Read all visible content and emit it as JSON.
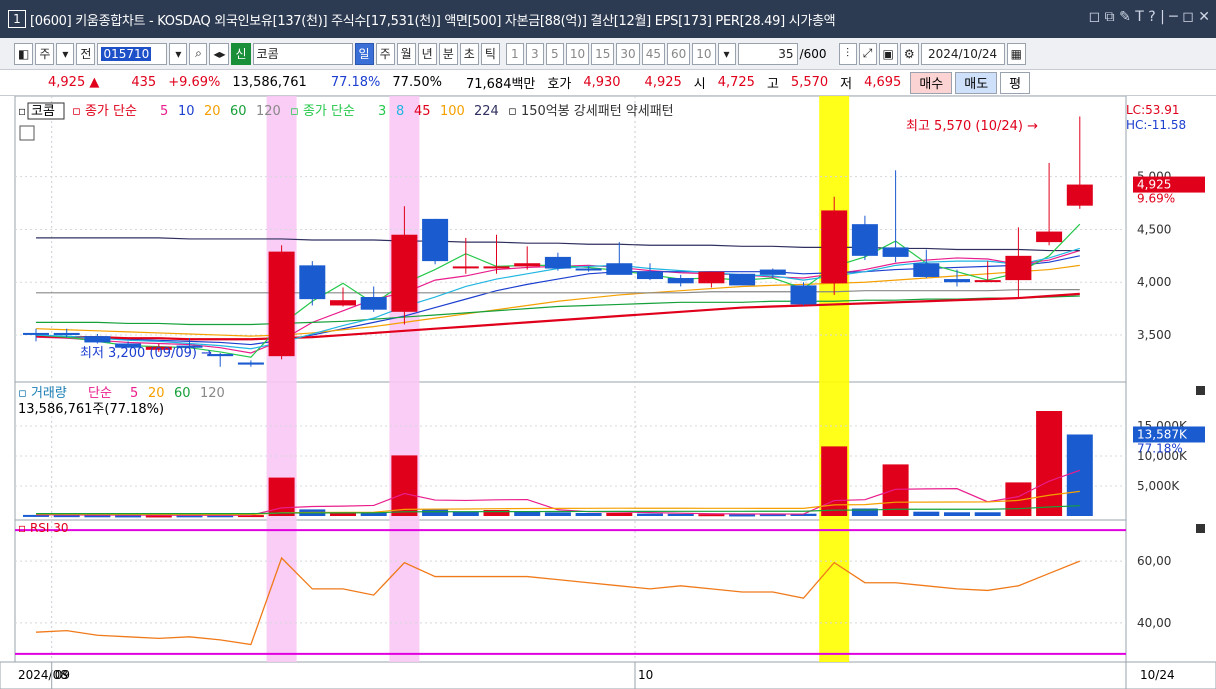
{
  "window": {
    "number": "1",
    "title": "[0600] 키움종합차트 - KOSDAQ 외국인보유[137(천)] 주식수[17,531(천)] 액면[500] 자본금[88(억)] 결산[12월] EPS[173] PER[28.49] 시가총액",
    "controls": "◻ ⧉ ✎ T ?  |  ─ ◻ ✕"
  },
  "toolbar": {
    "period_type": "주",
    "prev_label": "전",
    "code": "015710",
    "badge": "신",
    "name": "코콤",
    "periods": [
      "일",
      "주",
      "월",
      "년",
      "분",
      "초",
      "틱"
    ],
    "active_period": "일",
    "minutes": [
      "1",
      "3",
      "5",
      "10",
      "15",
      "30",
      "45",
      "60",
      "10"
    ],
    "count": "35",
    "count_total": "/600",
    "date": "2024/10/24"
  },
  "quote": {
    "price": "4,925",
    "arrow": "▲",
    "change": "435",
    "change_pct": "+9.69%",
    "volume": "13,586,761",
    "vol_ratio": "77.18%",
    "turnover": "77.50%",
    "amount": "71,684백만",
    "bid_label": "호가",
    "ask_price": "4,930",
    "bid_price": "4,925",
    "open_label": "시",
    "open": "4,725",
    "high_label": "고",
    "high": "5,570",
    "low_label": "저",
    "low": "4,695",
    "buy_label": "매수",
    "sell_label": "매도",
    "avg_label": "평"
  },
  "price_legend": {
    "name": "코콤",
    "ma_label": "종가 단순",
    "ma_periods": [
      "5",
      "10",
      "20",
      "60",
      "120"
    ],
    "ma_colors": [
      "#e91e8c",
      "#1c3fd0",
      "#f5a000",
      "#16a03a",
      "#888888"
    ],
    "ma2_label": "종가 단순",
    "ma2_periods": [
      "3",
      "8",
      "45",
      "100",
      "224"
    ],
    "ma2_colors": [
      "#25c84a",
      "#21b6e0",
      "#e0001b",
      "#f5a000",
      "#303060"
    ],
    "pattern_label": "150억봉 강세패턴  약세패턴"
  },
  "annotations": {
    "high": "최고 5,570 (10/24) →",
    "low": "최저 3,200 (09/09) →",
    "lc": "LC:53.91",
    "hc": "HC:-11.58",
    "last_price": "4,925",
    "last_pct": "9.69%"
  },
  "volume_legend": {
    "label": "거래량",
    "ma_label": "단순",
    "periods": [
      "5",
      "20",
      "60",
      "120"
    ],
    "colors": [
      "#e91e8c",
      "#f5a000",
      "#16a03a",
      "#888888"
    ],
    "current": "13,586,761주(77.18%)",
    "last_value": "13,587K",
    "last_pct": "77.18%"
  },
  "rsi_legend": {
    "label": "RSI 30"
  },
  "axis": {
    "dates": [
      "2024/08",
      "09",
      "10"
    ],
    "right_date": "10/24"
  },
  "chart_data": {
    "type": "candlestick",
    "price_ticks": [
      3500,
      4000,
      4500,
      5000
    ],
    "price_tick_labels": [
      "3,500",
      "4,000",
      "4,500",
      "5,000"
    ],
    "price_range": [
      3150,
      5650
    ],
    "candles": [
      {
        "o": 3520,
        "h": 3560,
        "l": 3440,
        "c": 3510
      },
      {
        "o": 3520,
        "h": 3560,
        "l": 3480,
        "c": 3500
      },
      {
        "o": 3490,
        "h": 3510,
        "l": 3420,
        "c": 3430
      },
      {
        "o": 3420,
        "h": 3440,
        "l": 3380,
        "c": 3380
      },
      {
        "o": 3360,
        "h": 3420,
        "l": 3340,
        "c": 3390
      },
      {
        "o": 3400,
        "h": 3470,
        "l": 3370,
        "c": 3380
      },
      {
        "o": 3320,
        "h": 3330,
        "l": 3200,
        "c": 3300
      },
      {
        "o": 3240,
        "h": 3260,
        "l": 3200,
        "c": 3220
      },
      {
        "o": 3300,
        "h": 4350,
        "l": 3270,
        "c": 4290
      },
      {
        "o": 4160,
        "h": 4200,
        "l": 3780,
        "c": 3840
      },
      {
        "o": 3780,
        "h": 3950,
        "l": 3770,
        "c": 3830
      },
      {
        "o": 3860,
        "h": 3960,
        "l": 3720,
        "c": 3740
      },
      {
        "o": 3720,
        "h": 4720,
        "l": 3600,
        "c": 4450
      },
      {
        "o": 4600,
        "h": 4600,
        "l": 4170,
        "c": 4200
      },
      {
        "o": 4140,
        "h": 4420,
        "l": 4080,
        "c": 4150
      },
      {
        "o": 4150,
        "h": 4450,
        "l": 4080,
        "c": 4150
      },
      {
        "o": 4150,
        "h": 4340,
        "l": 4120,
        "c": 4180
      },
      {
        "o": 4240,
        "h": 4280,
        "l": 4110,
        "c": 4130
      },
      {
        "o": 4130,
        "h": 4150,
        "l": 4100,
        "c": 4120
      },
      {
        "o": 4180,
        "h": 4380,
        "l": 4150,
        "c": 4070
      },
      {
        "o": 4100,
        "h": 4180,
        "l": 4020,
        "c": 4030
      },
      {
        "o": 4040,
        "h": 4070,
        "l": 3960,
        "c": 3990
      },
      {
        "o": 3990,
        "h": 4080,
        "l": 3950,
        "c": 4100
      },
      {
        "o": 4080,
        "h": 4080,
        "l": 3970,
        "c": 3970
      },
      {
        "o": 4120,
        "h": 4130,
        "l": 4040,
        "c": 4070
      },
      {
        "o": 3970,
        "h": 4000,
        "l": 3780,
        "c": 3790
      },
      {
        "o": 3990,
        "h": 4810,
        "l": 3880,
        "c": 4680
      },
      {
        "o": 4550,
        "h": 4630,
        "l": 4210,
        "c": 4250
      },
      {
        "o": 4330,
        "h": 5060,
        "l": 4190,
        "c": 4240
      },
      {
        "o": 4180,
        "h": 4310,
        "l": 4040,
        "c": 4050
      },
      {
        "o": 4030,
        "h": 4120,
        "l": 3960,
        "c": 4000
      },
      {
        "o": 4020,
        "h": 4200,
        "l": 4000,
        "c": 4020
      },
      {
        "o": 4020,
        "h": 4520,
        "l": 3860,
        "c": 4250
      },
      {
        "o": 4380,
        "h": 5130,
        "l": 4350,
        "c": 4480
      },
      {
        "o": 4725,
        "h": 5570,
        "l": 4695,
        "c": 4925
      }
    ],
    "ma_lines": [
      {
        "name": "5",
        "color": "#e91e8c",
        "values": [
          3480,
          3470,
          3450,
          3430,
          3420,
          3410,
          3380,
          3330,
          3450,
          3620,
          3730,
          3840,
          3900,
          4020,
          4060,
          4120,
          4140,
          4150,
          4160,
          4140,
          4110,
          4090,
          4080,
          4070,
          4050,
          4040,
          4080,
          4120,
          4180,
          4210,
          4230,
          4220,
          4170,
          4210,
          4300
        ]
      },
      {
        "name": "10",
        "color": "#1c3fd0",
        "values": [
          3490,
          3480,
          3470,
          3460,
          3450,
          3440,
          3430,
          3410,
          3450,
          3500,
          3560,
          3620,
          3680,
          3760,
          3840,
          3920,
          3980,
          4030,
          4080,
          4100,
          4100,
          4100,
          4100,
          4100,
          4100,
          4080,
          4090,
          4100,
          4120,
          4130,
          4140,
          4150,
          4160,
          4190,
          4250
        ]
      },
      {
        "name": "20",
        "color": "#f5a000",
        "values": [
          3560,
          3550,
          3540,
          3530,
          3520,
          3510,
          3500,
          3490,
          3500,
          3520,
          3550,
          3580,
          3620,
          3660,
          3700,
          3740,
          3780,
          3820,
          3850,
          3880,
          3900,
          3920,
          3940,
          3960,
          3970,
          3980,
          3990,
          4000,
          4020,
          4040,
          4060,
          4080,
          4100,
          4120,
          4160
        ]
      },
      {
        "name": "60",
        "color": "#16a03a",
        "values": [
          3620,
          3620,
          3620,
          3610,
          3610,
          3600,
          3600,
          3600,
          3610,
          3620,
          3630,
          3650,
          3670,
          3690,
          3710,
          3730,
          3750,
          3770,
          3780,
          3790,
          3800,
          3810,
          3810,
          3810,
          3820,
          3820,
          3820,
          3830,
          3830,
          3840,
          3840,
          3850,
          3850,
          3860,
          3870
        ]
      },
      {
        "name": "120",
        "color": "#888888",
        "values": [
          3900,
          3900,
          3900,
          3900,
          3900,
          3900,
          3900,
          3900,
          3900,
          3900,
          3900,
          3900,
          3900,
          3900,
          3900,
          3900,
          3900,
          3900,
          3900,
          3900,
          3900,
          3900,
          3910,
          3910,
          3910,
          3910,
          3910,
          3920,
          3920,
          3920,
          3920,
          3920,
          3930,
          3930,
          3930
        ]
      },
      {
        "name": "45",
        "color": "#e0001b",
        "values": [
          3490,
          3480,
          3480,
          3470,
          3470,
          3460,
          3460,
          3460,
          3470,
          3480,
          3500,
          3520,
          3540,
          3560,
          3580,
          3600,
          3620,
          3640,
          3660,
          3680,
          3700,
          3720,
          3740,
          3760,
          3770,
          3780,
          3790,
          3800,
          3810,
          3820,
          3830,
          3840,
          3850,
          3870,
          3890
        ]
      },
      {
        "name": "224",
        "color": "#303060",
        "values": [
          4420,
          4420,
          4420,
          4420,
          4420,
          4410,
          4410,
          4410,
          4410,
          4400,
          4400,
          4400,
          4390,
          4390,
          4380,
          4380,
          4370,
          4370,
          4360,
          4360,
          4350,
          4350,
          4350,
          4340,
          4340,
          4330,
          4330,
          4330,
          4320,
          4320,
          4310,
          4310,
          4310,
          4300,
          4300
        ]
      },
      {
        "name": "3",
        "color": "#25c84a",
        "values": [
          3500,
          3480,
          3440,
          3400,
          3390,
          3380,
          3340,
          3290,
          3600,
          3820,
          3990,
          3800,
          3990,
          4120,
          4270,
          4150,
          4160,
          4160,
          4140,
          4110,
          4070,
          4030,
          4040,
          4020,
          4040,
          3940,
          4150,
          4240,
          4390,
          4180,
          4100,
          4020,
          4090,
          4250,
          4550
        ]
      },
      {
        "name": "8",
        "color": "#21b6e0",
        "values": [
          3500,
          3490,
          3470,
          3450,
          3440,
          3420,
          3400,
          3370,
          3430,
          3510,
          3590,
          3660,
          3770,
          3860,
          3960,
          4030,
          4080,
          4130,
          4150,
          4160,
          4130,
          4110,
          4090,
          4070,
          4060,
          4020,
          4060,
          4100,
          4160,
          4190,
          4200,
          4200,
          4170,
          4230,
          4320
        ]
      }
    ],
    "volume_ticks": [
      "5,000K",
      "10,000K",
      "15,000K"
    ],
    "volume": [
      180,
      140,
      120,
      100,
      90,
      110,
      120,
      150,
      6400,
      1100,
      480,
      600,
      10100,
      1100,
      700,
      1000,
      780,
      600,
      500,
      520,
      400,
      360,
      300,
      260,
      310,
      380,
      11600,
      1250,
      8600,
      720,
      620,
      620,
      5600,
      17500,
      13587
    ],
    "volume_up": [
      false,
      false,
      false,
      false,
      true,
      false,
      false,
      true,
      true,
      false,
      true,
      false,
      true,
      false,
      false,
      true,
      false,
      false,
      false,
      true,
      false,
      false,
      true,
      false,
      false,
      false,
      true,
      false,
      true,
      false,
      false,
      false,
      true,
      true,
      false
    ],
    "volume_ma5": [
      200,
      190,
      170,
      160,
      140,
      130,
      120,
      130,
      1360,
      1580,
      1650,
      1760,
      3740,
      2660,
      2590,
      2700,
      2740,
      1040,
      720,
      680,
      560,
      470,
      380,
      340,
      330,
      320,
      2570,
      2720,
      4450,
      4520,
      4560,
      2360,
      3230,
      5810,
      7610
    ],
    "volume_ma20": [
      300,
      290,
      280,
      270,
      260,
      250,
      240,
      240,
      540,
      590,
      610,
      630,
      1100,
      1140,
      1170,
      1220,
      1250,
      1270,
      1280,
      1300,
      1290,
      1290,
      1280,
      1280,
      1270,
      1270,
      1850,
      1900,
      2300,
      2310,
      2330,
      2340,
      2600,
      3460,
      4100
    ],
    "volume_ma60": [
      400,
      400,
      400,
      400,
      400,
      400,
      400,
      400,
      500,
      510,
      520,
      530,
      700,
      710,
      720,
      730,
      740,
      750,
      760,
      770,
      770,
      780,
      780,
      780,
      790,
      790,
      980,
      990,
      1120,
      1120,
      1130,
      1130,
      1220,
      1500,
      1720
    ],
    "rsi_ticks": [
      "40,00",
      "60,00"
    ],
    "rsi": [
      37,
      37.5,
      36,
      35.5,
      35,
      35.5,
      34.5,
      33,
      61,
      51,
      51,
      49,
      59.5,
      55,
      55,
      55,
      55,
      54,
      53,
      52,
      51,
      52,
      51,
      50,
      50,
      48,
      59.5,
      53,
      53,
      52,
      51,
      50.5,
      52,
      56,
      60
    ],
    "rsi_levels": [
      70,
      30
    ],
    "highlights": [
      {
        "index": 8,
        "color": "#f8c8f4"
      },
      {
        "index": 12,
        "color": "#f8c8f4"
      },
      {
        "index": 26,
        "color": "#ffff00"
      }
    ],
    "x_ticks": [
      {
        "index": 1,
        "label": "09"
      },
      {
        "index": 20,
        "label": "10"
      }
    ]
  }
}
